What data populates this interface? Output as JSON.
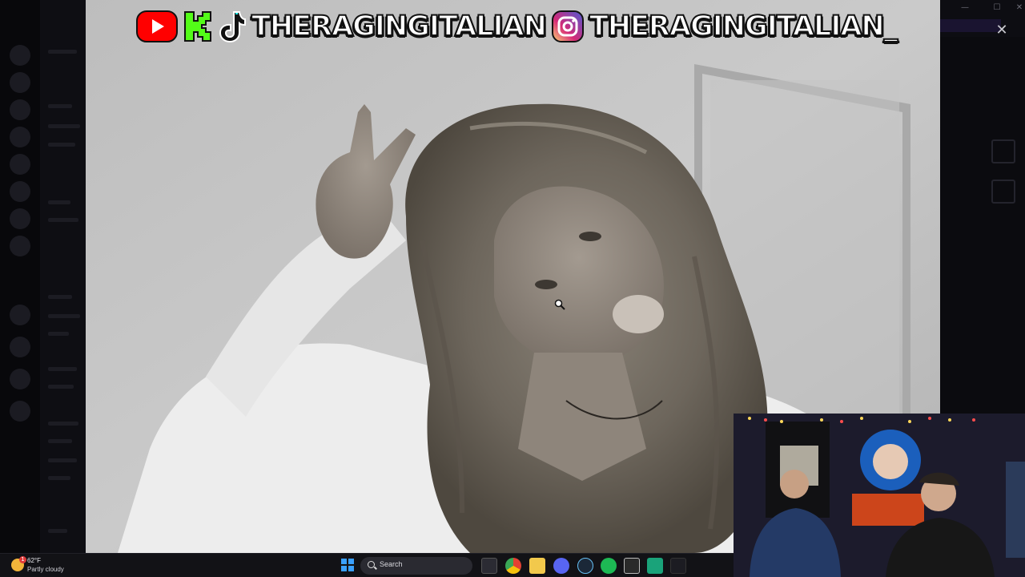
{
  "banner": {
    "handles": [
      "THERAGINGITALIAN",
      "THERAGINGITALIAN_"
    ],
    "icons": [
      "youtube-icon",
      "kick-icon",
      "tiktok-icon",
      "instagram-icon"
    ]
  },
  "taskbar": {
    "weather": {
      "temp": "62°F",
      "condition": "Partly cloudy",
      "badge": "1"
    },
    "search_placeholder": "Search",
    "pinned_apps": [
      "file-explorer",
      "chrome",
      "files",
      "discord",
      "steam",
      "spotify",
      "epic-games",
      "app",
      "app"
    ]
  },
  "colors": {
    "youtube": "#ff0000",
    "kick": "#53fc18",
    "instagram": "#d62976",
    "windows_blue": "#3aa0ff"
  }
}
